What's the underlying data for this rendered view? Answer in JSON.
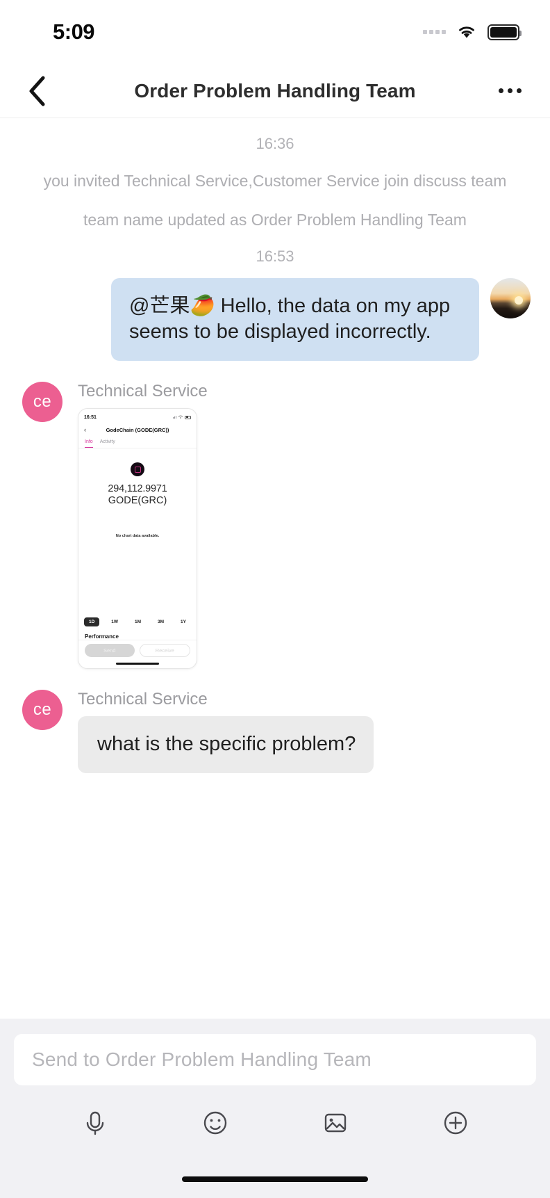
{
  "status_bar": {
    "time": "5:09",
    "signal_icon": "signal-dots-icon",
    "wifi_icon": "wifi-icon",
    "battery_icon": "battery-full-icon"
  },
  "nav": {
    "back_icon": "chevron-left-icon",
    "title": "Order Problem Handling Team",
    "more_icon": "more-horizontal-icon"
  },
  "chat": {
    "timestamp_1": "16:36",
    "system_note_1": "you invited Technical Service,Customer Service join discuss team",
    "system_note_2": "team name updated as Order Problem Handling Team",
    "timestamp_2": "16:53",
    "outgoing_message": "@芒果🥭 Hello, the data on my app seems to be displayed incorrectly.",
    "outgoing_avatar": "sunset-photo-avatar",
    "image_message": {
      "sender": "Technical Service",
      "avatar_initials": "ce",
      "screenshot": {
        "status_time": "16:51",
        "nav_back_icon": "chevron-left-icon",
        "nav_title": "GodeChain (GODE(GRC))",
        "tabs": [
          "Info",
          "Activity"
        ],
        "active_tab": "Info",
        "coin_logo": "gode-coin-icon",
        "balance_amount": "294,112.9971",
        "balance_symbol": "GODE(GRC)",
        "chart_empty_text": "No chart data available.",
        "ranges": [
          "1D",
          "1W",
          "1M",
          "3M",
          "1Y"
        ],
        "active_range": "1D",
        "performance_label": "Performance",
        "send_label": "Send",
        "receive_label": "Receive"
      }
    },
    "text_message": {
      "sender": "Technical Service",
      "avatar_initials": "ce",
      "text": "what is the specific problem?"
    }
  },
  "composer": {
    "input_placeholder": "Send to Order Problem Handling Team",
    "input_value": "",
    "tools": [
      {
        "name": "microphone-icon",
        "label": "Voice"
      },
      {
        "name": "smiley-icon",
        "label": "Emoji"
      },
      {
        "name": "image-icon",
        "label": "Photo"
      },
      {
        "name": "plus-circle-icon",
        "label": "More"
      }
    ]
  },
  "colors": {
    "outgoing_bubble": "#cfe0f2",
    "incoming_bubble": "#ebebeb",
    "avatar_pink": "#ec5f91",
    "accent_pink": "#d6399c",
    "composer_bg": "#f1f1f4"
  }
}
